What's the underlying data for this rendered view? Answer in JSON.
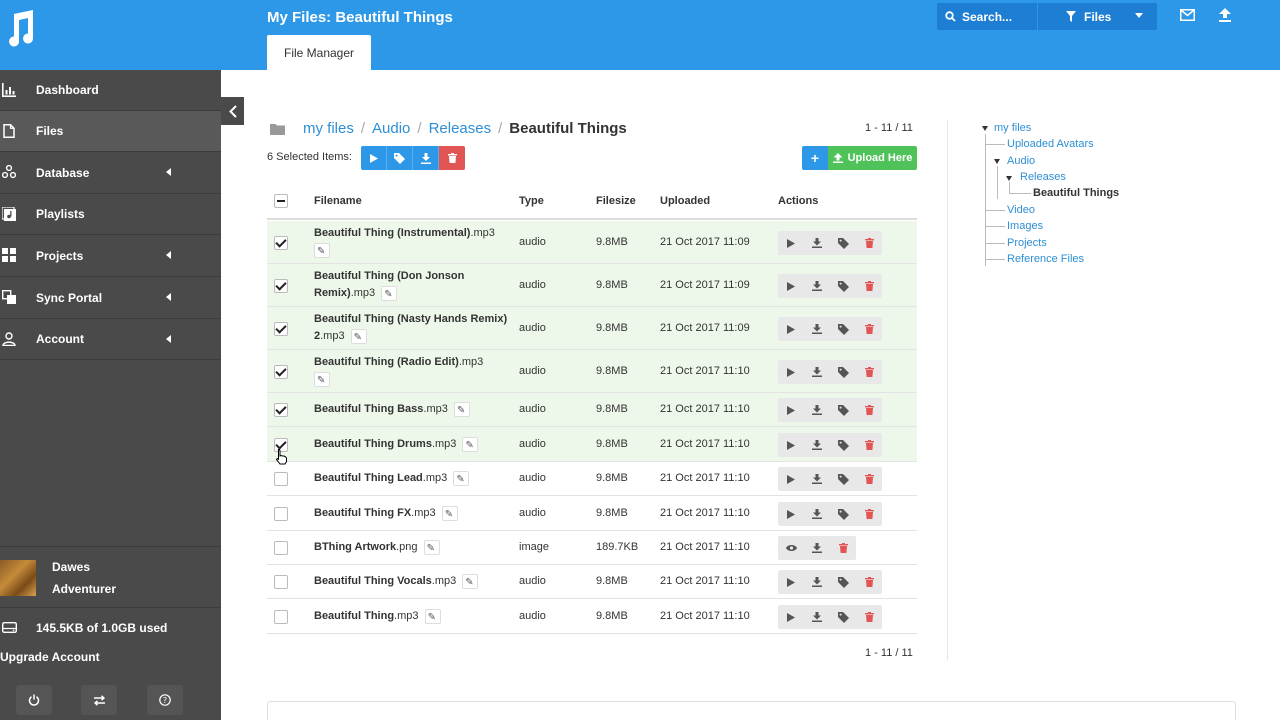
{
  "header": {
    "title": "My Files: Beautiful Things",
    "tab_label": "File Manager",
    "search_label": "Search...",
    "filter_label": "Files"
  },
  "sidebar": {
    "items": [
      {
        "label": "Dashboard",
        "icon": "bar-chart-icon"
      },
      {
        "label": "Files",
        "icon": "file-icon"
      },
      {
        "label": "Database",
        "icon": "database-icon"
      },
      {
        "label": "Playlists",
        "icon": "playlist-icon"
      },
      {
        "label": "Projects",
        "icon": "grid-icon"
      },
      {
        "label": "Sync Portal",
        "icon": "copy-icon"
      },
      {
        "label": "Account",
        "icon": "user-icon"
      }
    ],
    "user": {
      "name": "Dawes",
      "role": "Adventurer"
    },
    "storage": "145.5KB of 1.0GB used",
    "upgrade": "Upgrade Account"
  },
  "breadcrumb": {
    "items": [
      "my files",
      "Audio",
      "Releases"
    ],
    "current": "Beautiful Things",
    "separator": "/"
  },
  "pager": "1 - 11 / 11",
  "toolbar": {
    "selected_label": "6 Selected Items:",
    "add_label": "+",
    "upload_label": "Upload Here"
  },
  "table": {
    "headers": {
      "filename": "Filename",
      "type": "Type",
      "filesize": "Filesize",
      "uploaded": "Uploaded",
      "actions": "Actions"
    },
    "rows": [
      {
        "name_bold": "Beautiful Thing (Instrumental)",
        "ext": ".mp3",
        "type": "audio",
        "size": "9.8MB",
        "uploaded": "21 Oct 2017 11:09",
        "checked": true
      },
      {
        "name_bold": "Beautiful Thing (Don Jonson Remix)",
        "ext": ".mp3",
        "type": "audio",
        "size": "9.8MB",
        "uploaded": "21 Oct 2017 11:09",
        "checked": true
      },
      {
        "name_bold": "Beautiful Thing (Nasty Hands Remix) 2",
        "ext": ".mp3",
        "type": "audio",
        "size": "9.8MB",
        "uploaded": "21 Oct 2017 11:09",
        "checked": true
      },
      {
        "name_bold": "Beautiful Thing (Radio Edit)",
        "ext": ".mp3",
        "type": "audio",
        "size": "9.8MB",
        "uploaded": "21 Oct 2017 11:10",
        "checked": true
      },
      {
        "name_bold": "Beautiful Thing Bass",
        "ext": ".mp3",
        "type": "audio",
        "size": "9.8MB",
        "uploaded": "21 Oct 2017 11:10",
        "checked": true
      },
      {
        "name_bold": "Beautiful Thing Drums",
        "ext": ".mp3",
        "type": "audio",
        "size": "9.8MB",
        "uploaded": "21 Oct 2017 11:10",
        "checked": true
      },
      {
        "name_bold": "Beautiful Thing Lead",
        "ext": ".mp3",
        "type": "audio",
        "size": "9.8MB",
        "uploaded": "21 Oct 2017 11:10",
        "checked": false
      },
      {
        "name_bold": "Beautiful Thing FX",
        "ext": ".mp3",
        "type": "audio",
        "size": "9.8MB",
        "uploaded": "21 Oct 2017 11:10",
        "checked": false
      },
      {
        "name_bold": "BThing Artwork",
        "ext": ".png",
        "type": "image",
        "size": "189.7KB",
        "uploaded": "21 Oct 2017 11:10",
        "checked": false
      },
      {
        "name_bold": "Beautiful Thing Vocals",
        "ext": ".mp3",
        "type": "audio",
        "size": "9.8MB",
        "uploaded": "21 Oct 2017 11:10",
        "checked": false
      },
      {
        "name_bold": "Beautiful Thing",
        "ext": ".mp3",
        "type": "audio",
        "size": "9.8MB",
        "uploaded": "21 Oct 2017 11:10",
        "checked": false
      }
    ]
  },
  "tree": {
    "root": "my files",
    "children": [
      "Uploaded Avatars",
      "Audio",
      "Releases",
      "Beautiful Things",
      "Video",
      "Images",
      "Projects",
      "Reference Files"
    ]
  },
  "colors": {
    "brand": "#2d98e8",
    "success": "#4fc25a",
    "danger": "#e25555",
    "sidebar": "#4a4a4a",
    "selected_row": "#eef8ea"
  }
}
